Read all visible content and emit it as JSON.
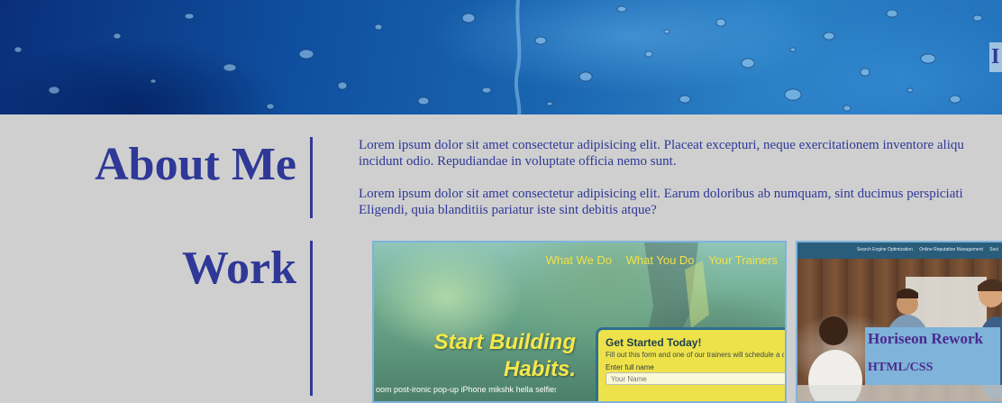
{
  "header": {
    "nav_item_partial": "I"
  },
  "about": {
    "title": "About Me",
    "paragraph1_line1": "Lorem ipsum dolor sit amet consectetur adipisicing elit. Placeat excepturi, neque exercitationem inventore aliqu",
    "paragraph1_line2": "incidunt odio. Repudiandae in voluptate officia nemo sunt.",
    "paragraph2_line1": "Lorem ipsum dolor sit amet consectetur adipisicing elit. Earum doloribus ab numquam, sint ducimus perspiciati",
    "paragraph2_line2": "Eligendi, quia blanditiis pariatur iste sint debitis atque?"
  },
  "work": {
    "title": "Work",
    "project1": {
      "nav": [
        "What We Do",
        "What You Do",
        "Your Trainers"
      ],
      "headline_line1": "Start Building",
      "headline_line2": "Habits.",
      "subtext": "oom post-ironic pop-up iPhone mikshk hella selfies",
      "form_title": "Get Started Today!",
      "form_desc": "Fill out this form and one of our trainers will schedule a co",
      "form_label": "Enter full name",
      "form_placeholder": "Your Name"
    },
    "project2": {
      "topnav": [
        "Search Engine Optimization",
        "Online Reputation Management",
        "Soci"
      ],
      "title": "Horiseon Rework",
      "tag": "HTML/CSS"
    }
  },
  "colors": {
    "page_bg": "#cfcfcf",
    "accent": "#2f3897",
    "card_border": "#7fb3d9",
    "overlay_text": "#4a2a8f"
  }
}
